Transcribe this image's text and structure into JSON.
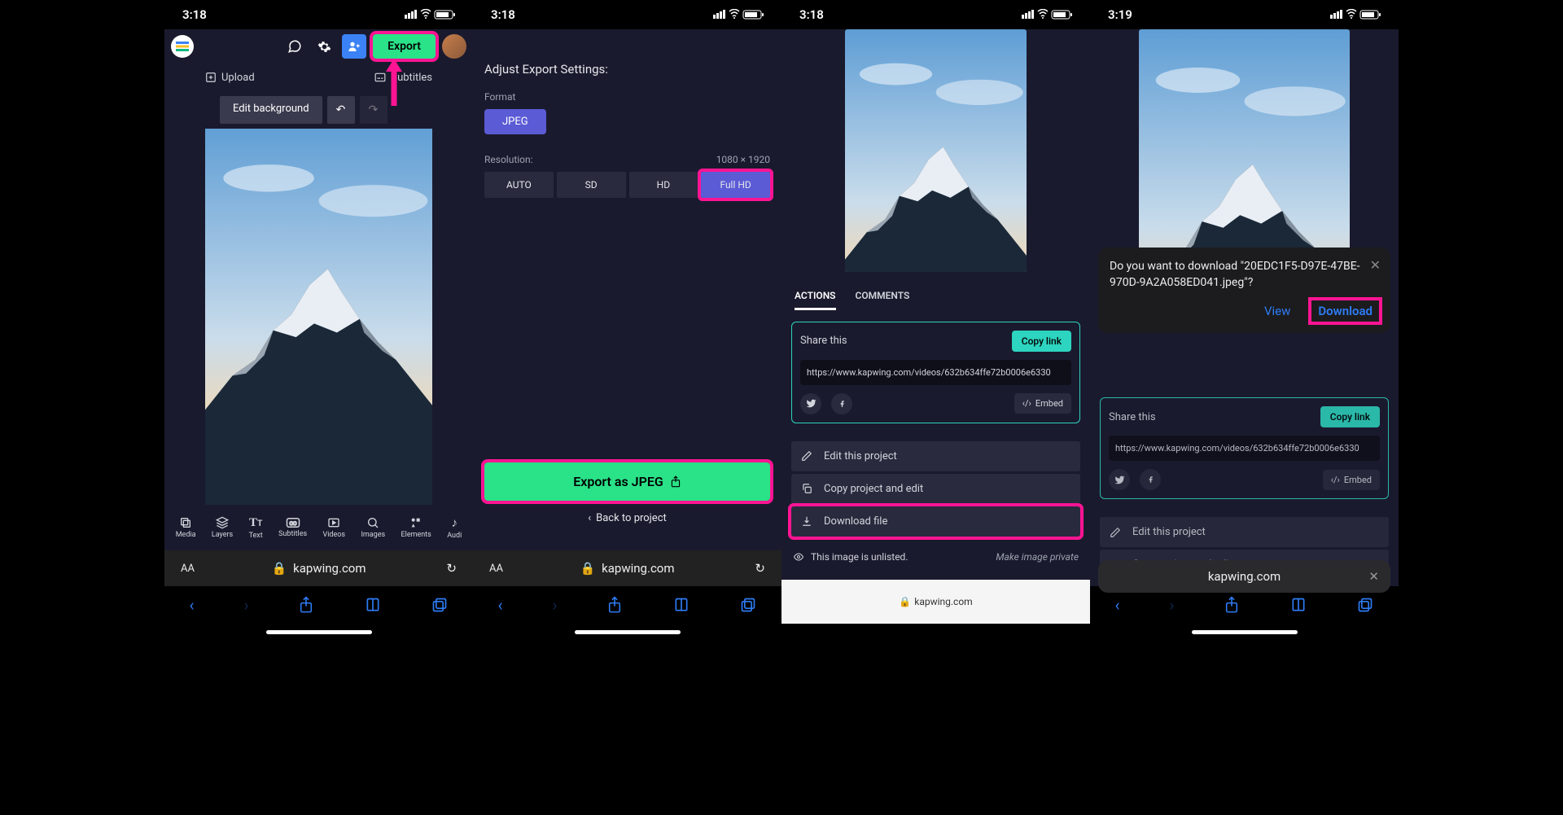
{
  "statusbar": {
    "time_1": "3:18",
    "time_4": "3:19"
  },
  "screen1": {
    "export_label": "Export",
    "upload_label": "Upload",
    "subtitles_label": "Subtitles",
    "edit_bg_label": "Edit background",
    "tools": {
      "media": "Media",
      "layers": "Layers",
      "text": "Text",
      "subtitles": "Subtitles",
      "videos": "Videos",
      "images": "Images",
      "elements": "Elements",
      "audio": "Audi"
    },
    "url": "kapwing.com"
  },
  "screen2": {
    "title": "Adjust Export Settings:",
    "format_label": "Format",
    "format_value": "JPEG",
    "resolution_label": "Resolution:",
    "resolution_value": "1080 × 1920",
    "res_opts": {
      "auto": "AUTO",
      "sd": "SD",
      "hd": "HD",
      "fullhd": "Full HD"
    },
    "export_as_label": "Export as JPEG",
    "back_label": "Back to project",
    "url": "kapwing.com"
  },
  "screen3": {
    "tabs": {
      "actions": "ACTIONS",
      "comments": "COMMENTS"
    },
    "share_label": "Share this",
    "copy_link_label": "Copy link",
    "share_url": "https://www.kapwing.com/videos/632b634ffe72b0006e6330",
    "embed_label": "Embed",
    "actions": {
      "edit": "Edit this project",
      "copy": "Copy project and edit",
      "download": "Download file"
    },
    "privacy_text": "This image is unlisted.",
    "make_private_label": "Make image private",
    "url": "kapwing.com"
  },
  "screen4": {
    "prompt_text": "Do you want to download \"20EDC1F5-D97E-47BE-970D-9A2A058ED041.jpeg\"?",
    "view_label": "View",
    "download_label": "Download",
    "share_label": "Share this",
    "copy_link_label": "Copy link",
    "share_url": "https://www.kapwing.com/videos/632b634ffe72b0006e6330",
    "embed_label": "Embed",
    "actions": {
      "edit": "Edit this project",
      "copy": "Copy project and edit"
    },
    "url": "kapwing.com"
  }
}
